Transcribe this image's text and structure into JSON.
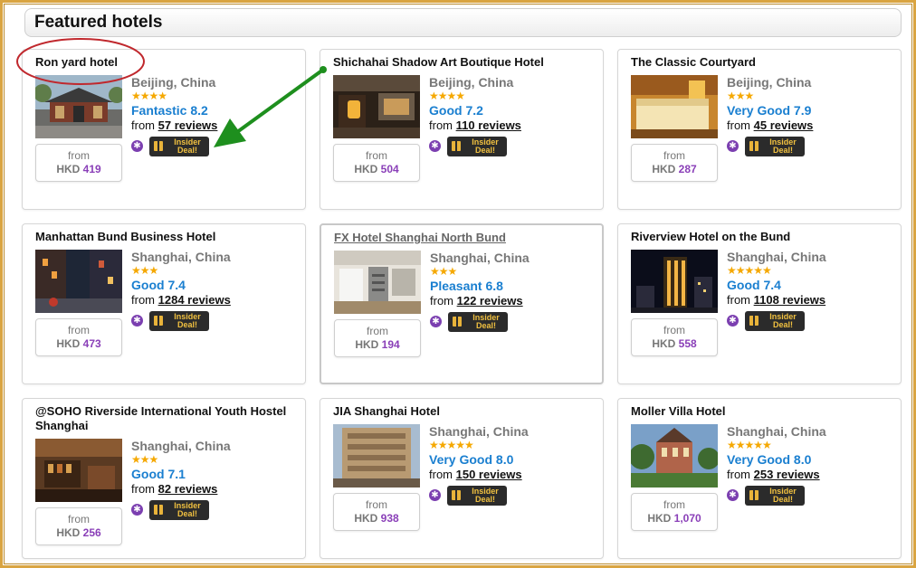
{
  "header": {
    "title": "Featured hotels"
  },
  "price_from_label": "from",
  "deal_label": "Insider Deal!",
  "currency": "HKD",
  "colors": {
    "rating": "#1a7fd0",
    "price": "#8a3fb8",
    "stars": "#f5a800",
    "annotation_ellipse": "#c0282d",
    "annotation_arrow": "#1e8f1e"
  },
  "hotels": [
    {
      "name": "Ron yard hotel",
      "location": "Beijing, China",
      "stars": "★★★★",
      "rating_word": "Fantastic",
      "rating_score": "8.2",
      "reviews_prefix": "from",
      "reviews_link": "57 reviews",
      "price": "419",
      "image": "chinese-courtyard"
    },
    {
      "name": "Shichahai Shadow Art Boutique Hotel",
      "location": "Beijing, China",
      "stars": "★★★★",
      "rating_word": "Good",
      "rating_score": "7.2",
      "reviews_prefix": "from",
      "reviews_link": "110 reviews",
      "price": "504",
      "image": "lantern-courtyard"
    },
    {
      "name": "The Classic Courtyard",
      "location": "Beijing, China",
      "stars": "★★★",
      "rating_word": "Very Good",
      "rating_score": "7.9",
      "reviews_prefix": "from",
      "reviews_link": "45 reviews",
      "price": "287",
      "image": "bedroom"
    },
    {
      "name": "Manhattan Bund Business Hotel",
      "location": "Shanghai, China",
      "stars": "★★★",
      "rating_word": "Good",
      "rating_score": "7.4",
      "reviews_prefix": "from",
      "reviews_link": "1284 reviews",
      "price": "473",
      "image": "night-street"
    },
    {
      "name": "FX Hotel Shanghai North Bund",
      "location": "Shanghai, China",
      "stars": "★★★",
      "rating_word": "Pleasant",
      "rating_score": "6.8",
      "reviews_prefix": "from",
      "reviews_link": "122 reviews",
      "price": "194",
      "image": "lobby"
    },
    {
      "name": "Riverview Hotel on the Bund",
      "location": "Shanghai, China",
      "stars": "★★★★★",
      "rating_word": "Good",
      "rating_score": "7.4",
      "reviews_prefix": "from",
      "reviews_link": "1108 reviews",
      "price": "558",
      "image": "night-tower"
    },
    {
      "name": "@SOHO Riverside International Youth Hostel Shanghai",
      "location": "Shanghai, China",
      "stars": "★★★",
      "rating_word": "Good",
      "rating_score": "7.1",
      "reviews_prefix": "from",
      "reviews_link": "82 reviews",
      "price": "256",
      "image": "hostel-bar"
    },
    {
      "name": "JIA Shanghai Hotel",
      "location": "Shanghai, China",
      "stars": "★★★★★",
      "rating_word": "Very Good",
      "rating_score": "8.0",
      "reviews_prefix": "from",
      "reviews_link": "150 reviews",
      "price": "938",
      "image": "facade"
    },
    {
      "name": "Moller Villa Hotel",
      "location": "Shanghai, China",
      "stars": "★★★★★",
      "rating_word": "Very Good",
      "rating_score": "8.0",
      "reviews_prefix": "from",
      "reviews_link": "253 reviews",
      "price": "1,070",
      "image": "villa"
    }
  ]
}
